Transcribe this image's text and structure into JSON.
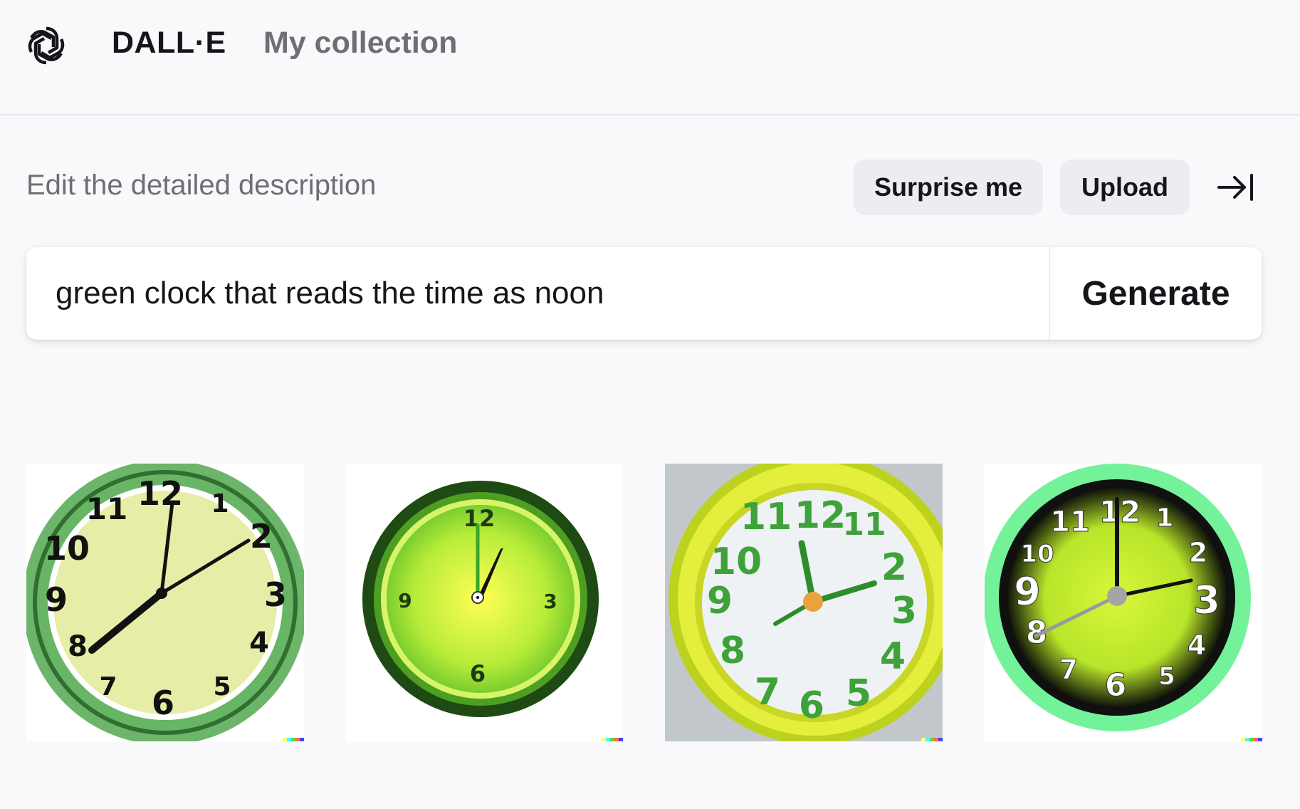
{
  "app": {
    "brand": "DALL·E",
    "nav_collection": "My collection",
    "logo_icon": "openai-logo-icon"
  },
  "editor": {
    "section_label": "Edit the detailed description",
    "surprise_label": "Surprise me",
    "upload_label": "Upload",
    "collapse_icon": "collapse-right-icon",
    "prompt_value": "green clock that reads the time as noon",
    "generate_label": "Generate"
  },
  "results": {
    "images": [
      {
        "description_id": "result-1",
        "style": "pale-yellow face, green rim"
      },
      {
        "description_id": "result-2",
        "style": "lime glowing face, dark green rim"
      },
      {
        "description_id": "result-3",
        "style": "white face, yellow rim, green numerals"
      },
      {
        "description_id": "result-4",
        "style": "black-lime face, mint rim"
      }
    ],
    "clock1_numerals": [
      "12",
      "1",
      "2",
      "3",
      "4",
      "5",
      "6",
      "7",
      "8",
      "9",
      "10",
      "11"
    ],
    "clock2_numerals": [
      "12",
      "3",
      "6",
      "9"
    ],
    "clock3_numerals": [
      "12",
      "2",
      "3",
      "4",
      "5",
      "6",
      "7",
      "8",
      "9",
      "10",
      "11",
      "11"
    ],
    "clock4_numerals": [
      "12",
      "1",
      "2",
      "3",
      "4",
      "5",
      "6",
      "7",
      "8",
      "9",
      "10",
      "11"
    ]
  },
  "colors": {
    "watermark": [
      "#ffff66",
      "#42ffff",
      "#51da4c",
      "#ff6e3c",
      "#3c46ff"
    ]
  }
}
